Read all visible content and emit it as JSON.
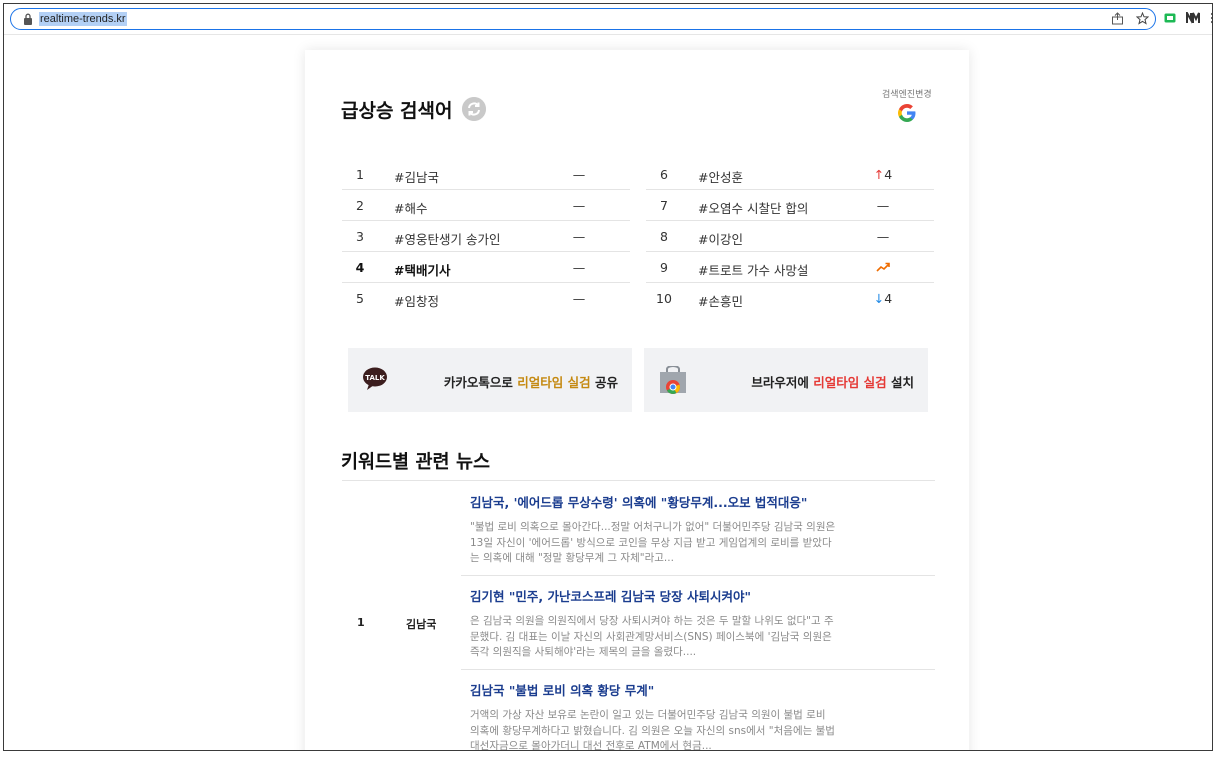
{
  "browser": {
    "url": "realtime-trends.kr"
  },
  "page": {
    "title": "급상승 검색어",
    "engine_change_label": "검색엔진변경"
  },
  "rankings": [
    {
      "rank": "1",
      "keyword": "#김남국",
      "change": "—",
      "change_type": "same"
    },
    {
      "rank": "2",
      "keyword": "#해수",
      "change": "—",
      "change_type": "same"
    },
    {
      "rank": "3",
      "keyword": "#영웅탄생기 송가인",
      "change": "—",
      "change_type": "same"
    },
    {
      "rank": "4",
      "keyword": "#택배기사",
      "change": "—",
      "change_type": "same"
    },
    {
      "rank": "5",
      "keyword": "#임창정",
      "change": "—",
      "change_type": "same"
    },
    {
      "rank": "6",
      "keyword": "#안성훈",
      "change": "4",
      "change_type": "up"
    },
    {
      "rank": "7",
      "keyword": "#오염수 시찰단 합의",
      "change": "—",
      "change_type": "same"
    },
    {
      "rank": "8",
      "keyword": "#이강인",
      "change": "—",
      "change_type": "same"
    },
    {
      "rank": "9",
      "keyword": "#트로트 가수 사망설",
      "change": "",
      "change_type": "new"
    },
    {
      "rank": "10",
      "keyword": "#손흥민",
      "change": "4",
      "change_type": "down"
    }
  ],
  "promos": {
    "kakao": {
      "pre": "카카오톡으로 ",
      "highlight": "리얼타임 실검",
      "post": " 공유",
      "icon": "kakao-talk-icon"
    },
    "browser": {
      "pre": "브라우저에 ",
      "highlight": "리얼타임 실검",
      "post": " 설치",
      "icon": "chrome-webstore-icon"
    }
  },
  "news": {
    "title": "키워드별 관련 뉴스",
    "groups": [
      {
        "rank": "1",
        "keyword": "김남국",
        "articles": [
          {
            "headline": "김남국, '에어드롭 무상수령' 의혹에 \"황당무계...오보 법적대응\"",
            "body": "\"불법 로비 의혹으로 몰아간다...정말 어처구니가 없어\" 더불어민주당 김남국 의원은 13일 자신이 '에어드롭' 방식으로 코인을 무상 지급 받고 게임업계의 로비를 받았다는 의혹에 대해 \"정말 황당무계 그 자체\"라고..."
          },
          {
            "headline": "김기현 \"민주, 가난코스프레 김남국 당장 사퇴시켜야\"",
            "body": "은 김남국 의원을 의원직에서 당장 사퇴시켜야 하는 것은 두 말할 나위도 없다\"고 주문했다. 김 대표는 이날 자신의 사회관계망서비스(SNS) 페이스북에 '김남국 의원은 즉각 의원직을 사퇴해야'라는 제목의 글을 올렸다...."
          },
          {
            "headline": "김남국 \"불법 로비 의혹 황당 무계\"",
            "body": "거액의 가상 자산 보유로 논란이 일고 있는 더불어민주당 김남국 의원이 불법 로비 의혹에 황당무계하다고 밝혔습니다. 김 의원은 오늘 자신의 sns에서 \"처음에는 불법 대선자금으로 몰아가더니 대선 전후로 ATM에서 현금..."
          }
        ]
      }
    ]
  },
  "colors": {
    "headline_blue": "#1b3d8f",
    "highlight_gold": "#c58a12",
    "highlight_red": "#e53935",
    "up_red": "#e53935",
    "down_blue": "#1e88e5",
    "new_orange": "#ef6c00"
  }
}
